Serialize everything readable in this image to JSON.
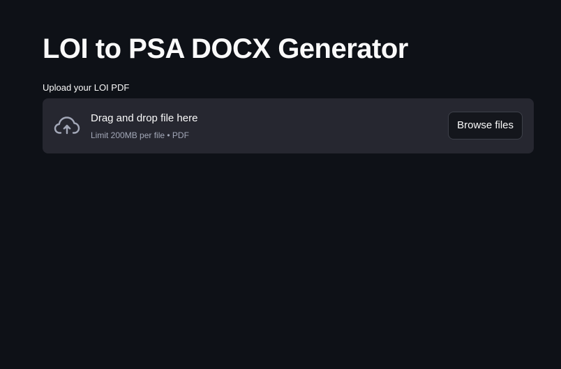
{
  "page": {
    "title": "LOI to PSA DOCX Generator"
  },
  "uploader": {
    "label": "Upload your LOI PDF",
    "dropzone_title": "Drag and drop file here",
    "dropzone_subtitle": "Limit 200MB per file • PDF",
    "browse_label": "Browse files",
    "icon": "cloud-upload-icon"
  },
  "colors": {
    "background": "#0e1117",
    "dropzone": "#262730",
    "text": "#fafafa",
    "muted_text": "#a3a8b8",
    "button_background": "#14161c",
    "button_border": "#3d4049"
  }
}
